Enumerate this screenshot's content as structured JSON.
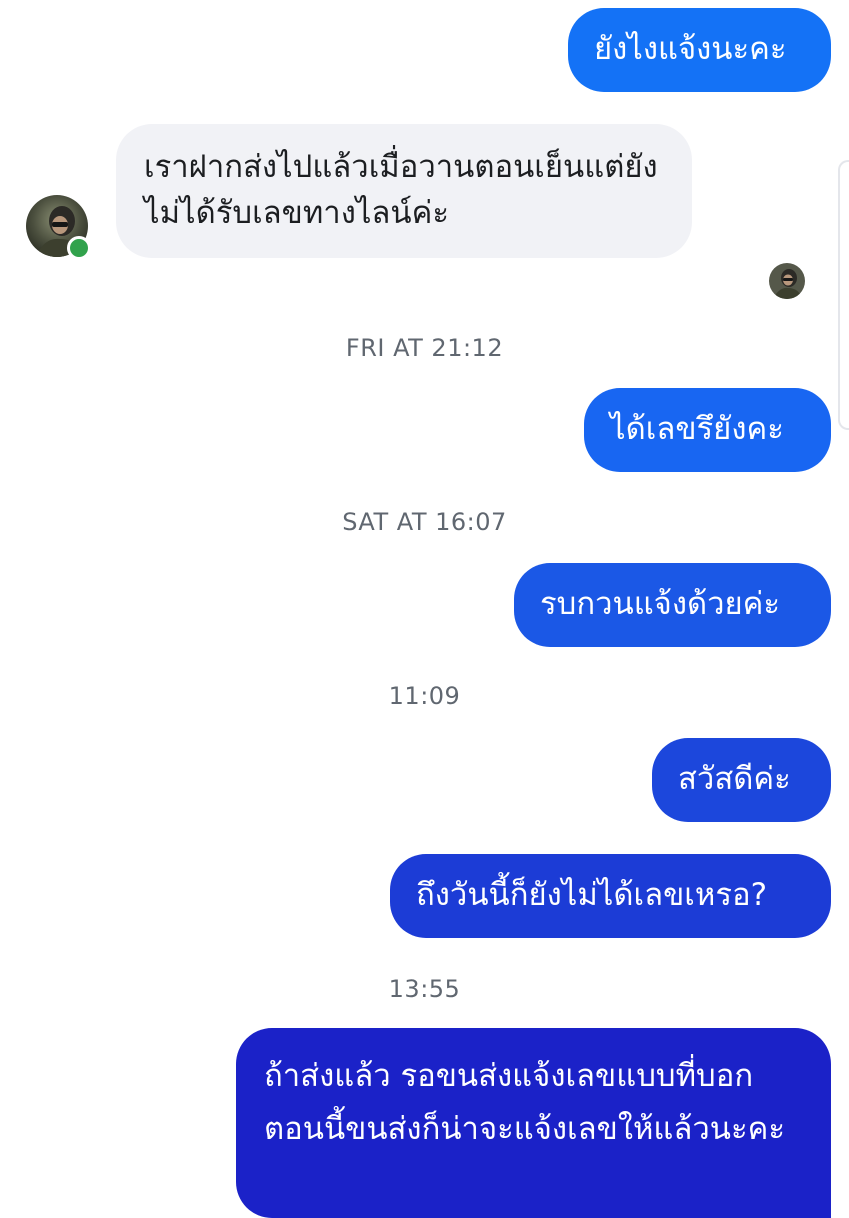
{
  "conversation": {
    "messages": [
      {
        "text": "ยังไงแจ้งนะคะ"
      },
      {
        "text": "เราฝากส่งไปแล้วเมื่อวานตอนเย็นแต่ยังไม่ได้รับเลขทางไลน์ค่ะ"
      },
      {
        "text": "ได้เลขรึยังคะ"
      },
      {
        "text": "รบกวนแจ้งด้วยค่ะ"
      },
      {
        "text": "สวัสดีค่ะ"
      },
      {
        "text": "ถึงวันนี้ก็ยังไม่ได้เลขเหรอ?"
      },
      {
        "text": "ถ้าส่งแล้ว รอขนส่งแจ้งเลขแบบที่บอก ตอนนี้ขนส่งก็น่าจะแจ้งเลขให้แล้วนะคะ"
      }
    ],
    "timestamps": [
      "FRI AT 21:12",
      "SAT AT 16:07",
      "11:09",
      "13:55"
    ]
  },
  "colors": {
    "outgoing_bubble_light": "#0a7cff",
    "outgoing_bubble_mid": "#1d4fd8",
    "outgoing_bubble_dark": "#1a1fc8",
    "incoming_bubble": "#f1f2f6",
    "online_indicator": "#31a24c",
    "timestamp_text": "#606770"
  },
  "icons": {
    "contact_avatar": "contact-avatar-icon",
    "read_receipt": "read-receipt-avatar-icon",
    "online": "online-status-icon"
  }
}
